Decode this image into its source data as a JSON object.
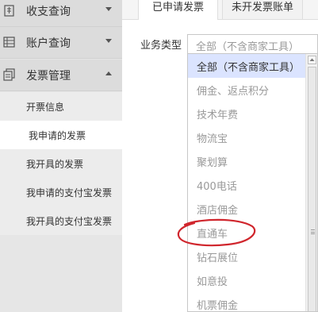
{
  "sidebar": {
    "menus": [
      {
        "label": "收支查询",
        "icon": "ledger-icon",
        "arrow": "chevron-down"
      },
      {
        "label": "账户查询",
        "icon": "grid-icon",
        "arrow": "chevron-down"
      },
      {
        "label": "发票管理",
        "icon": "invoice-icon",
        "arrow": "chevron-up"
      }
    ],
    "invoice_submenu": [
      "开票信息",
      "我申请的发票",
      "我开具的发票",
      "我申请的支付宝发票",
      "我开具的支付宝发票"
    ],
    "active_submenu": "我申请的发票"
  },
  "tabs": {
    "active": "已申请发票",
    "inactive": "未开发票账单"
  },
  "filter": {
    "label": "业务类型",
    "selected": "全部（不含商家工具）"
  },
  "dropdown": {
    "options": [
      "全部（不含商家工具）",
      "佣金、返点积分",
      "技术年费",
      "物流宝",
      "聚划算",
      "400电话",
      "酒店佣金",
      "直通车",
      "钻石展位",
      "如意投",
      "机票佣金"
    ],
    "highlighted": "全部（不含商家工具）",
    "circled": "直通车"
  },
  "colors": {
    "sidebar_bg": "#e6e6e6",
    "highlight_bg": "#dbe4ff",
    "annotation": "#d0262d",
    "muted_text": "#999999"
  }
}
